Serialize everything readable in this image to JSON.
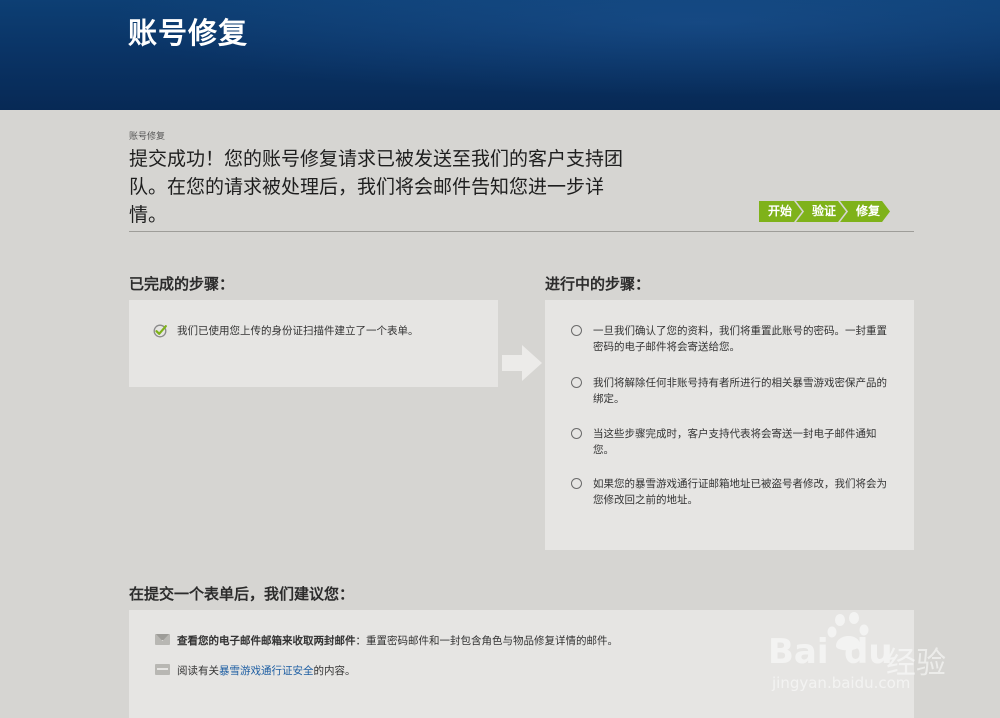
{
  "header": {
    "title": "账号修复"
  },
  "breadcrumb": "账号修复",
  "headline": "提交成功！您的账号修复请求已被发送至我们的客户支持团队。在您的请求被处理后，我们将会邮件告知您进一步详情。",
  "steps": [
    "开始",
    "验证",
    "修复"
  ],
  "completed": {
    "title": "已完成的步骤：",
    "items": [
      "我们已使用您上传的身份证扫描件建立了一个表单。"
    ]
  },
  "in_progress": {
    "title": "进行中的步骤：",
    "items": [
      "一旦我们确认了您的资料，我们将重置此账号的密码。一封重置密码的电子邮件将会寄送给您。",
      "我们将解除任何非账号持有者所进行的相关暴雪游戏密保产品的绑定。",
      "当这些步骤完成时，客户支持代表将会寄送一封电子邮件通知您。",
      "如果您的暴雪游戏通行证邮箱地址已被盗号者修改，我们将会为您修改回之前的地址。"
    ]
  },
  "advice": {
    "title": "在提交一个表单后，我们建议您：",
    "item1_bold": "查看您的电子邮件邮箱来收取两封邮件",
    "item1_rest": "：重置密码邮件和一封包含角色与物品修复详情的邮件。",
    "item2_prefix": "阅读有关",
    "item2_link": "暴雪游戏通行证安全",
    "item2_suffix": "的内容。"
  },
  "watermark": {
    "brand": "Bai",
    "brand2": "du",
    "suffix": "经验",
    "url": "jingyan.baidu.com"
  },
  "colors": {
    "header": "#0a3466",
    "step_green": "#7fb21a",
    "link": "#1f5fa3",
    "background": "#d6d5d2"
  },
  "icons": [
    "check-icon",
    "radio-icon",
    "arrow-right-icon",
    "mail-icon",
    "card-icon"
  ]
}
